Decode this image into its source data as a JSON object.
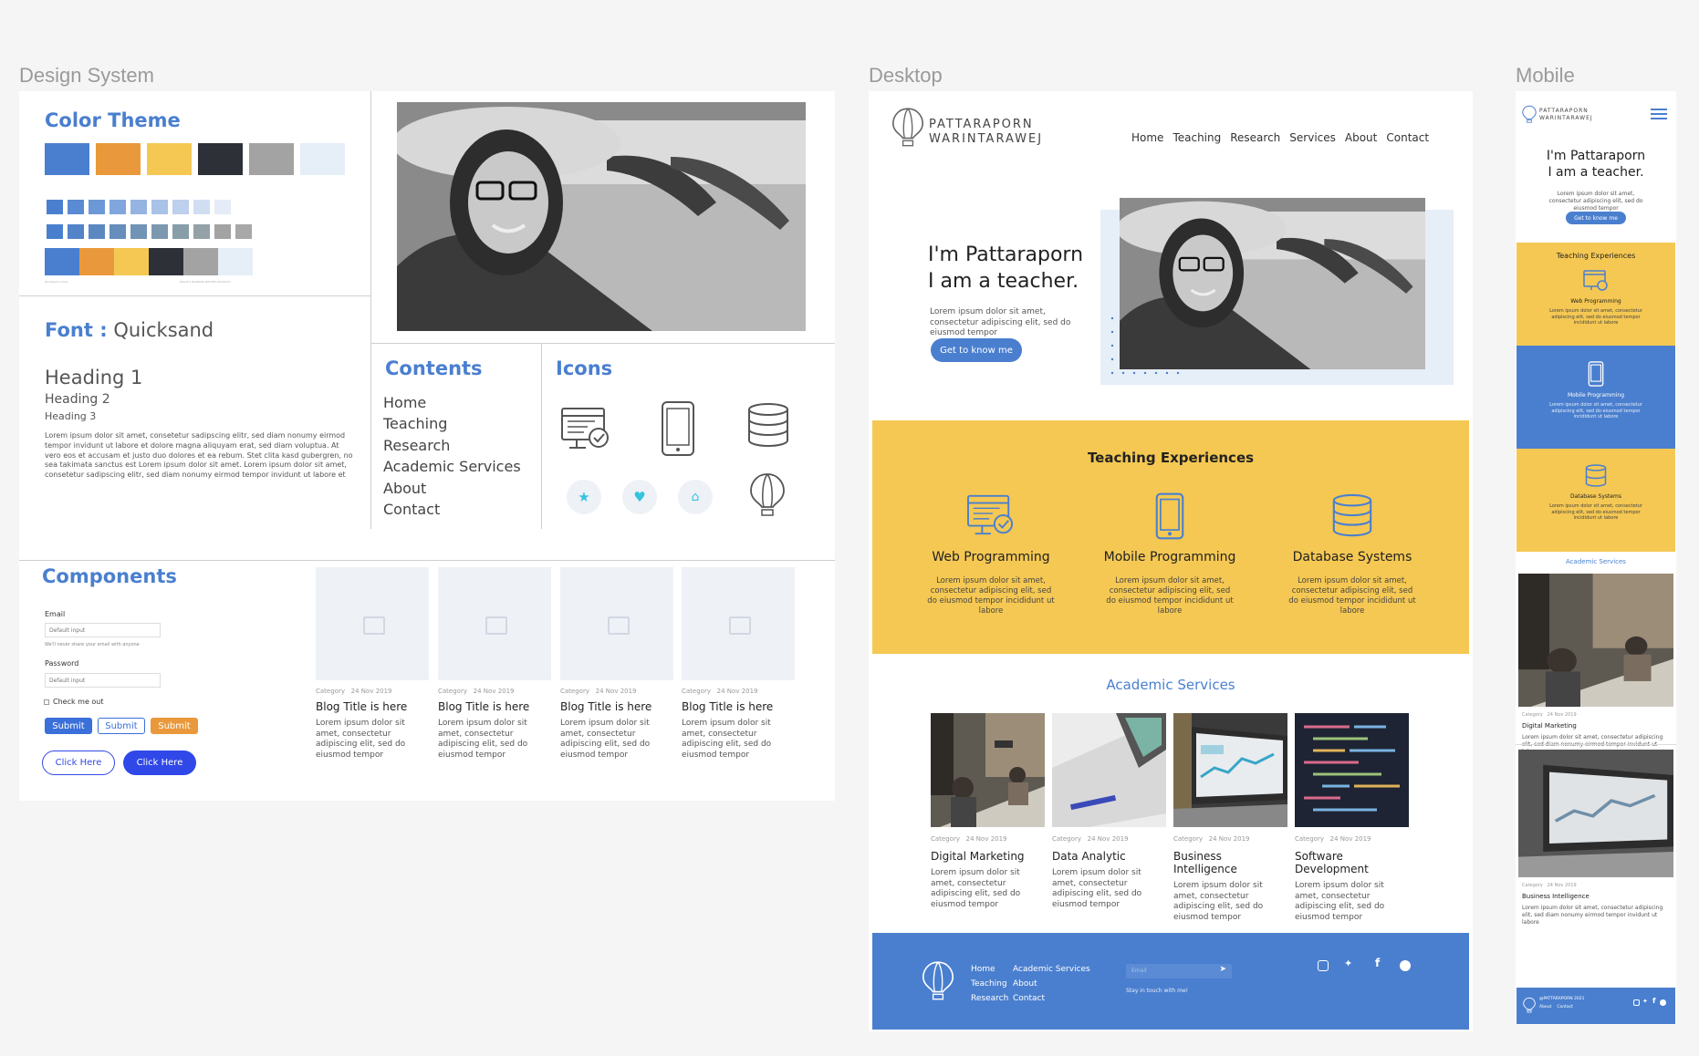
{
  "labels": {
    "design_system": "Design System",
    "desktop": "Desktop",
    "mobile": "Mobile"
  },
  "colors": {
    "blue": "#4a7fcf",
    "orange": "#e9993b",
    "yellow": "#f5c853",
    "dark": "#2d3137",
    "gray": "#a3a3a3",
    "light": "#e6eef8",
    "button_blue": "#3048e8"
  },
  "ds": {
    "color_theme_title": "Color Theme",
    "color_note_left": "Quicksand colors",
    "color_note_right": "#4a7fcf #e9993b #f5c853 #2d3137",
    "font_title": "Font :",
    "font_name": "Quicksand",
    "heading1": "Heading 1",
    "heading2": "Heading 2",
    "heading3": "Heading 3",
    "paragraph": "Lorem ipsum dolor sit amet, consetetur sadipscing elitr, sed diam nonumy eirmod tempor invidunt ut labore et dolore magna aliquyam erat, sed diam voluptua. At vero eos et accusam et justo duo dolores et ea rebum. Stet clita kasd gubergren, no sea takimata sanctus est Lorem ipsum dolor sit amet. Lorem ipsum dolor sit amet, consetetur sadipscing elitr, sed diam nonumy eirmod tempor invidunt ut labore et",
    "contents_title": "Contents",
    "contents_items": [
      "Home",
      "Teaching",
      "Research",
      "Academic Services",
      "About",
      "Contact"
    ],
    "icons_title": "Icons",
    "components_title": "Components",
    "email_label": "Email",
    "email_placeholder": "Default input",
    "email_help": "We'll never share your email with anyone",
    "password_label": "Password",
    "password_placeholder": "Default input",
    "checkbox_label": "Check me out",
    "submit_labels": [
      "Submit",
      "Submit",
      "Submit"
    ],
    "click_here_labels": [
      "Click Here",
      "Click Here"
    ],
    "cards": [
      {
        "category": "Category",
        "date": "24 Nov 2019",
        "title": "Blog Title is here",
        "text": "Lorem ipsum dolor sit amet, consectetur adipiscing elit, sed do eiusmod tempor"
      },
      {
        "category": "Category",
        "date": "24 Nov 2019",
        "title": "Blog Title is here",
        "text": "Lorem ipsum dolor sit amet, consectetur adipiscing elit, sed do eiusmod tempor"
      },
      {
        "category": "Category",
        "date": "24 Nov 2019",
        "title": "Blog Title is here",
        "text": "Lorem ipsum dolor sit amet, consectetur adipiscing elit, sed do eiusmod tempor"
      },
      {
        "category": "Category",
        "date": "24 Nov 2019",
        "title": "Blog Title is here",
        "text": "Lorem ipsum dolor sit amet, consectetur adipiscing elit, sed do eiusmod tempor"
      }
    ]
  },
  "desktop": {
    "logo_line1": "PATTARAPORN",
    "logo_line2": "WARINTARAWEJ",
    "nav": [
      "Home",
      "Teaching",
      "Research",
      "Services",
      "About",
      "Contact"
    ],
    "hero_title1": "I'm Pattaraporn",
    "hero_title2": "I am a teacher.",
    "hero_text": "Lorem ipsum dolor sit amet, consectetur adipiscing elit, sed do eiusmod tempor",
    "hero_button": "Get to know me",
    "teaching_title": "Teaching Experiences",
    "teaching": [
      {
        "title": "Web Programming",
        "text": "Lorem ipsum dolor sit amet, consectetur adipiscing elit, sed do eiusmod tempor incididunt ut labore"
      },
      {
        "title": "Mobile Programming",
        "text": "Lorem ipsum dolor sit amet, consectetur adipiscing elit, sed do eiusmod tempor incididunt ut labore"
      },
      {
        "title": "Database Systems",
        "text": "Lorem ipsum dolor sit amet, consectetur adipiscing elit, sed do eiusmod tempor incididunt ut labore"
      }
    ],
    "services_title": "Academic Services",
    "services": [
      {
        "category": "Category",
        "date": "24 Nov 2019",
        "title": "Digital Marketing",
        "text": "Lorem ipsum dolor sit amet, consectetur adipiscing elit, sed do eiusmod tempor"
      },
      {
        "category": "Category",
        "date": "24 Nov 2019",
        "title": "Data Analytic",
        "text": "Lorem ipsum dolor sit amet, consectetur adipiscing elit, sed do eiusmod tempor"
      },
      {
        "category": "Category",
        "date": "24 Nov 2019",
        "title": "Business Intelligence",
        "text": "Lorem ipsum dolor sit amet, consectetur adipiscing elit, sed do eiusmod tempor"
      },
      {
        "category": "Category",
        "date": "24 Nov 2019",
        "title": "Software Development",
        "text": "Lorem ipsum dolor sit amet, consectetur adipiscing elit, sed do eiusmod tempor"
      }
    ],
    "footer_links_col1": [
      "Home",
      "Teaching",
      "Research"
    ],
    "footer_links_col2": [
      "Academic Services",
      "About",
      "Contact"
    ],
    "footer_email_placeholder": "Email",
    "footer_note": "Stay in touch with me!"
  },
  "mobile": {
    "logo_line1": "PATTARAPORN",
    "logo_line2": "WARINTARAWEJ",
    "hero_title1": "I'm Pattaraporn",
    "hero_title2": "I am a teacher.",
    "hero_text": "Lorem ipsum dolor sit amet, consectetur adipiscing elit, sed do eiusmod tempor",
    "hero_button": "Get to know me",
    "teaching_title": "Teaching Experiences",
    "teaching": [
      {
        "title": "Web Programming",
        "text": "Lorem ipsum dolor sit amet, consectetur adipiscing elit, sed do eiusmod tempor incididunt ut labore"
      },
      {
        "title": "Mobile Programming",
        "text": "Lorem ipsum dolor sit amet, consectetur adipiscing elit, sed do eiusmod tempor incididunt ut labore"
      },
      {
        "title": "Database Systems",
        "text": "Lorem ipsum dolor sit amet, consectetur adipiscing elit, sed do eiusmod tempor incididunt ut labore"
      }
    ],
    "services_title": "Academic Services",
    "services": [
      {
        "category": "Category",
        "date": "24 Nov 2019",
        "title": "Digital Marketing",
        "text": "Lorem ipsum dolor sit amet, consectetur adipiscing elit, sed diam nonumy eirmod tempor invidunt ut labore"
      },
      {
        "category": "Category",
        "date": "24 Nov 2019",
        "title": "Business Intelligence",
        "text": "Lorem ipsum dolor sit amet, consectetur adipiscing elit, sed diam nonumy eirmod tempor invidunt ut labore"
      }
    ],
    "footer_copy": "@PATTARAPORN 2021",
    "footer_links": [
      "About",
      "Contact"
    ]
  }
}
